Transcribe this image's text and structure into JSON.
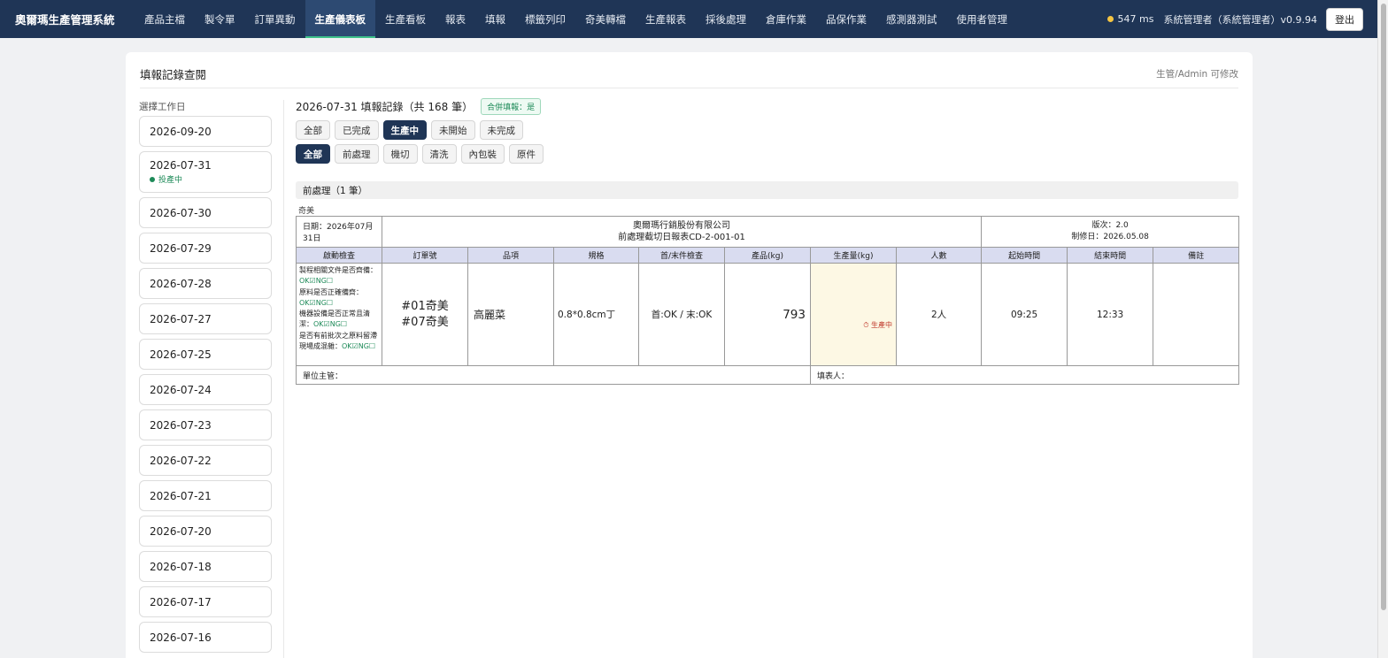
{
  "app": {
    "title": "奧爾瑪生產管理系統",
    "latency": "547 ms",
    "user": "系統管理者（系統管理者）v0.9.94",
    "logout_label": "登出"
  },
  "nav": {
    "items": [
      "產品主檔",
      "製令單",
      "訂單異動",
      "生產儀表板",
      "生產看板",
      "報表",
      "填報",
      "標籤列印",
      "奇美轉檔",
      "生產報表",
      "採後處理",
      "倉庫作業",
      "品保作業",
      "感測器測試",
      "使用者管理"
    ],
    "active_index": 3
  },
  "page": {
    "title": "填報記錄查閱",
    "permission_note": "生管/Admin 可修改"
  },
  "sidebar": {
    "label": "選擇工作日",
    "days": [
      {
        "date": "2026-09-20",
        "status": ""
      },
      {
        "date": "2026-07-31",
        "status": "投產中"
      },
      {
        "date": "2026-07-30",
        "status": ""
      },
      {
        "date": "2026-07-29",
        "status": ""
      },
      {
        "date": "2026-07-28",
        "status": ""
      },
      {
        "date": "2026-07-27",
        "status": ""
      },
      {
        "date": "2026-07-25",
        "status": ""
      },
      {
        "date": "2026-07-24",
        "status": ""
      },
      {
        "date": "2026-07-23",
        "status": ""
      },
      {
        "date": "2026-07-22",
        "status": ""
      },
      {
        "date": "2026-07-21",
        "status": ""
      },
      {
        "date": "2026-07-20",
        "status": ""
      },
      {
        "date": "2026-07-18",
        "status": ""
      },
      {
        "date": "2026-07-17",
        "status": ""
      },
      {
        "date": "2026-07-16",
        "status": ""
      }
    ]
  },
  "records": {
    "title": "2026-07-31 填報記錄（共 168 筆）",
    "merge_badge": "合併填報：是",
    "status_filters": [
      "全部",
      "已完成",
      "生產中",
      "未開始",
      "未完成"
    ],
    "status_active": 2,
    "process_filters": [
      "全部",
      "前處理",
      "機切",
      "清洗",
      "內包裝",
      "原件"
    ],
    "process_active": 0
  },
  "section": {
    "title": "前處理（1 筆）",
    "customer": "奇美"
  },
  "report": {
    "date": "日期：2026年07月31日",
    "company": "奧爾瑪行銷股份有限公司",
    "form_name": "前處理截切日報表CD-2-001-01",
    "version": "版次：2.0",
    "revised": "制修日：2026.05.08",
    "columns": [
      "啟動檢查",
      "訂單號",
      "品項",
      "規格",
      "首/末件檢查",
      "產品(kg)",
      "生產量(kg)",
      "人數",
      "起始時間",
      "結束時間",
      "備註"
    ],
    "checks": [
      {
        "text": "製程相關文件是否齊備：",
        "ok": "OK☑NG☐"
      },
      {
        "text": "原料是否正確備齊：",
        "ok": "OK☑NG☐"
      },
      {
        "text": "機器設備是否正常且清潔：",
        "ok": "OK☑NG☐"
      },
      {
        "text": "是否有前批次之原料留滯現場成混雜：",
        "ok": "OK☑NG☐"
      }
    ],
    "row": {
      "order_1": "#01奇美",
      "order_2": "#07奇美",
      "item": "高麗菜",
      "spec": "0.8*0.8cm丁",
      "inspection": "首:OK / 末:OK",
      "product_kg": "793",
      "output_status": "⏱ 生產中",
      "people": "2人",
      "start": "09:25",
      "end": "12:33",
      "note": ""
    },
    "supervisor": "單位主管：",
    "filler": "填表人："
  }
}
